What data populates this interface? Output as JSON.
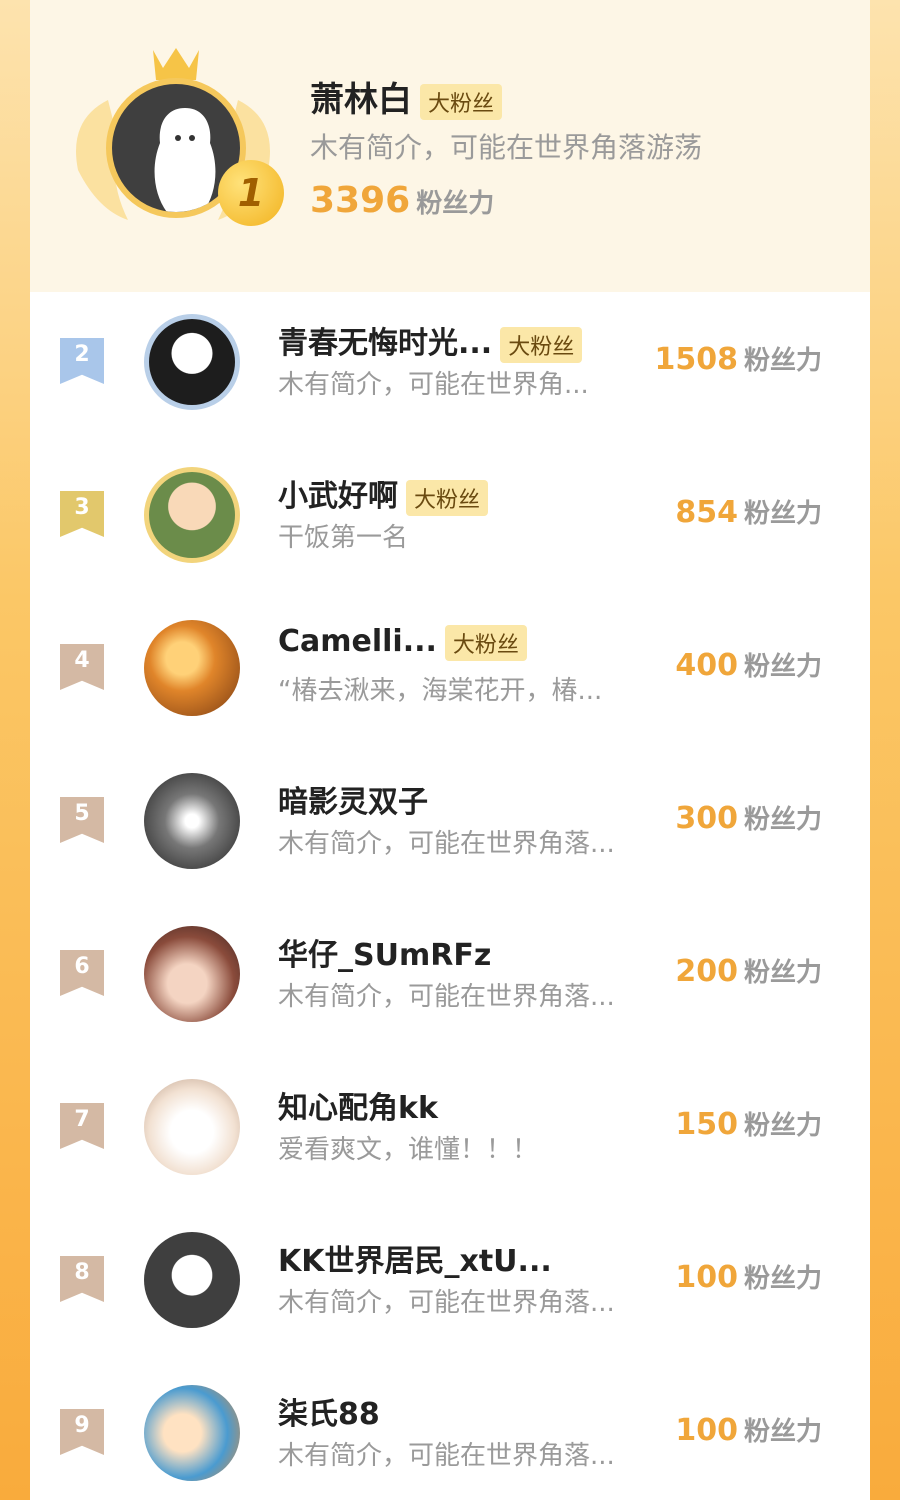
{
  "score_unit": "粉丝力",
  "tag_label": "大粉丝",
  "top": {
    "rank": "1",
    "name": "萧林白",
    "intro": "木有简介，可能在世界角落游荡",
    "score": "3396"
  },
  "rows": [
    {
      "rank": "2",
      "name": "青春无悔时光...",
      "intro": "木有简介，可能在世界角...",
      "score": "1508",
      "tag": true
    },
    {
      "rank": "3",
      "name": "小武好啊",
      "intro": "干饭第一名",
      "score": "854",
      "tag": true
    },
    {
      "rank": "4",
      "name": "Camelli...",
      "intro": "“椿去湫来，海棠花开，椿...",
      "score": "400",
      "tag": true
    },
    {
      "rank": "5",
      "name": "暗影灵双子",
      "intro": "木有简介，可能在世界角落...",
      "score": "300",
      "tag": false
    },
    {
      "rank": "6",
      "name": "华仔_SUmRFz",
      "intro": "木有简介，可能在世界角落...",
      "score": "200",
      "tag": false
    },
    {
      "rank": "7",
      "name": "知心配角kk",
      "intro": "爱看爽文，谁懂！！！",
      "score": "150",
      "tag": false
    },
    {
      "rank": "8",
      "name": "KK世界居民_xtU...",
      "intro": "木有简介，可能在世界角落...",
      "score": "100",
      "tag": false
    },
    {
      "rank": "9",
      "name": "柒氏88",
      "intro": "木有简介，可能在世界角落...",
      "score": "100",
      "tag": false
    }
  ],
  "colors": {
    "accent": "#f0a63a",
    "rank2": "#a9c6ea",
    "rank3": "#e2c86c",
    "rank_other": "#d4b9a4"
  }
}
